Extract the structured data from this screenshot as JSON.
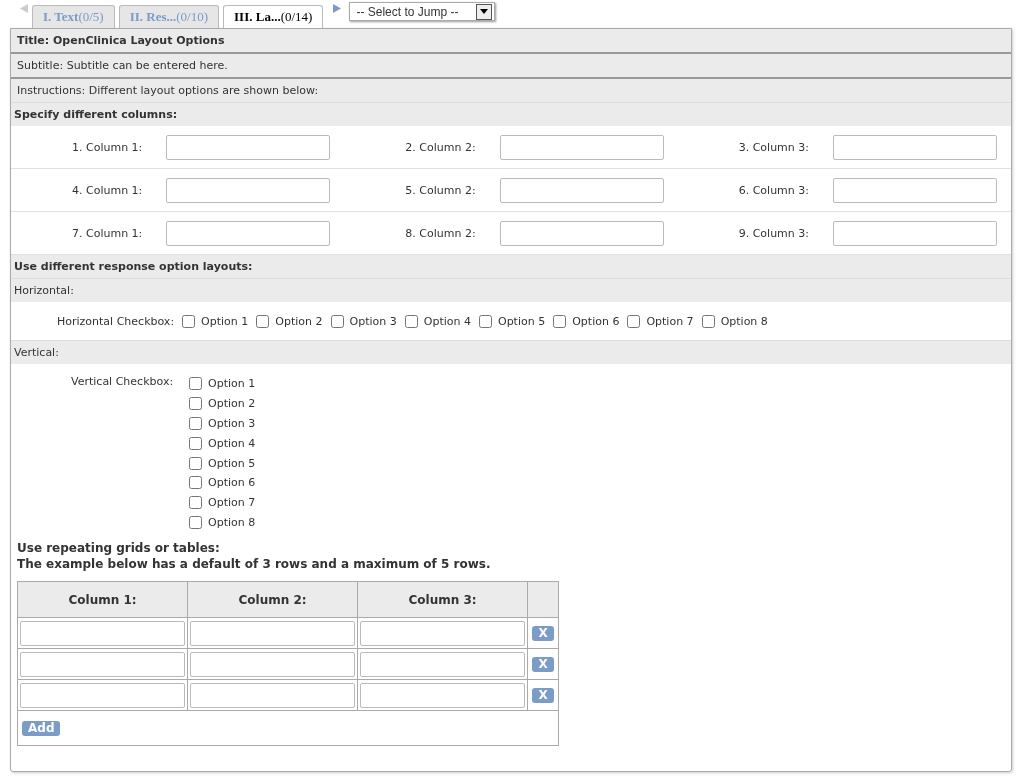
{
  "tabs": [
    {
      "name": "I. Text",
      "count": "(0/5)",
      "selected": false
    },
    {
      "name": "II. Res...",
      "count": "(0/10)",
      "selected": false
    },
    {
      "name": "III. La...",
      "count": "(0/14)",
      "selected": true
    }
  ],
  "jump": {
    "value": "-- Select to Jump --"
  },
  "header": {
    "title": "Title: OpenClinica Layout Options",
    "subtitle": "Subtitle: Subtitle can be entered here.",
    "instructions": "Instructions: Different layout options are shown below:"
  },
  "columns_section": {
    "heading": "Specify different columns:",
    "rows": [
      [
        "1. Column 1:",
        "2. Column 2:",
        "3. Column 3:"
      ],
      [
        "4. Column 1:",
        "5. Column 2:",
        "6. Column 3:"
      ],
      [
        "7. Column 1:",
        "8. Column 2:",
        "9. Column 3:"
      ]
    ]
  },
  "layouts_section": {
    "heading": "Use different response option layouts:",
    "horizontal": {
      "subheading": "Horizontal:",
      "label": "Horizontal Checkbox:",
      "options": [
        {
          "label": "Option 1",
          "checked": false
        },
        {
          "label": "Option 2",
          "checked": false
        },
        {
          "label": "Option 3",
          "checked": false
        },
        {
          "label": "Option 4",
          "checked": false
        },
        {
          "label": "Option 5",
          "checked": false
        },
        {
          "label": "Option 6",
          "checked": false
        },
        {
          "label": "Option 7",
          "checked": false
        },
        {
          "label": "Option 8",
          "checked": false
        }
      ]
    },
    "vertical": {
      "subheading": "Vertical:",
      "label": "Vertical Checkbox:",
      "options": [
        {
          "label": "Option 1",
          "checked": false
        },
        {
          "label": "Option 2",
          "checked": false
        },
        {
          "label": "Option 3",
          "checked": false
        },
        {
          "label": "Option 4",
          "checked": false
        },
        {
          "label": "Option 5",
          "checked": false
        },
        {
          "label": "Option 6",
          "checked": false
        },
        {
          "label": "Option 7",
          "checked": false
        },
        {
          "label": "Option 8",
          "checked": false
        }
      ]
    }
  },
  "grid_section": {
    "heading": "Use repeating grids or tables:",
    "note": "The example below has a default of 3 rows and a maximum of 5 rows.",
    "columns": [
      "Column 1:",
      "Column 2:",
      "Column 3:"
    ],
    "row_count_buttons": [
      "X",
      "X",
      "X"
    ],
    "add_button": "Add"
  }
}
